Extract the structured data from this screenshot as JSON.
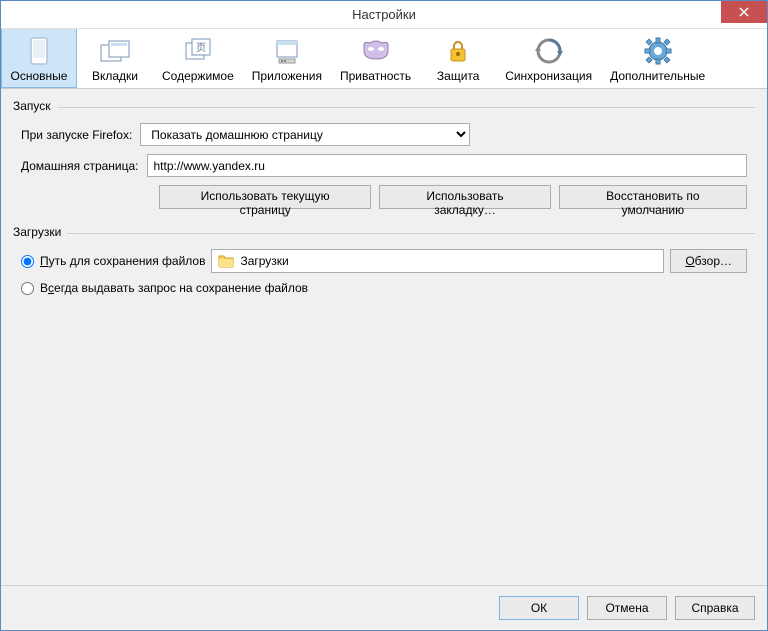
{
  "window": {
    "title": "Настройки"
  },
  "toolbar": {
    "items": [
      {
        "label": "Основные"
      },
      {
        "label": "Вкладки"
      },
      {
        "label": "Содержимое"
      },
      {
        "label": "Приложения"
      },
      {
        "label": "Приватность"
      },
      {
        "label": "Защита"
      },
      {
        "label": "Синхронизация"
      },
      {
        "label": "Дополнительные"
      }
    ]
  },
  "startup": {
    "group_label": "Запуск",
    "launch_label": "При запуске Firefox:",
    "launch_value": "Показать домашнюю страницу",
    "homepage_label": "Домашняя страница:",
    "homepage_value": "http://www.yandex.ru",
    "btn_current": "Использовать текущую страницу",
    "btn_bookmark": "Использовать закладку…",
    "btn_restore": "Восстановить по умолчанию"
  },
  "downloads": {
    "group_label": "Загрузки",
    "radio_save": "Путь для сохранения файлов",
    "folder_name": "Загрузки",
    "btn_browse": "Обзор…",
    "radio_ask": "Всегда выдавать запрос на сохранение файлов"
  },
  "footer": {
    "ok": "ОК",
    "cancel": "Отмена",
    "help": "Справка"
  }
}
